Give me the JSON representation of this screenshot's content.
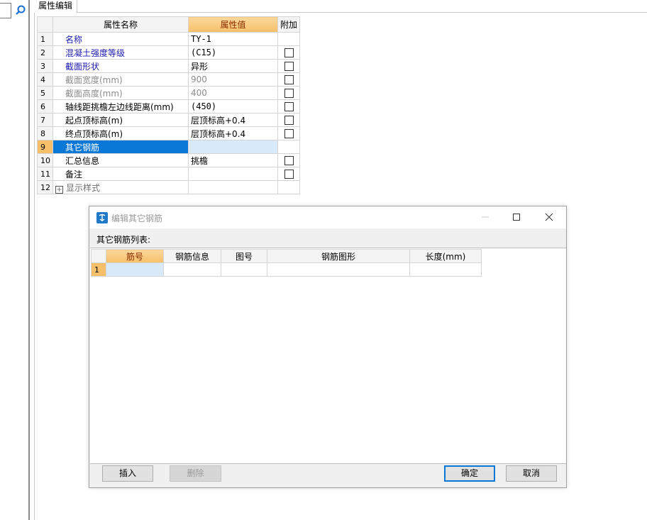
{
  "tab": {
    "label": "属性编辑"
  },
  "grid": {
    "headers": {
      "name": "属性名称",
      "value": "属性值",
      "extra": "附加"
    },
    "rows": [
      {
        "no": "1",
        "name": "名称",
        "value": "TY-1"
      },
      {
        "no": "2",
        "name": "混凝土强度等级",
        "value": "(C15)"
      },
      {
        "no": "3",
        "name": "截面形状",
        "value": "异形"
      },
      {
        "no": "4",
        "name": "截面宽度(mm)",
        "value": "900"
      },
      {
        "no": "5",
        "name": "截面高度(mm)",
        "value": "400"
      },
      {
        "no": "6",
        "name": "轴线距挑檐左边线距离(mm)",
        "value": "(450)"
      },
      {
        "no": "7",
        "name": "起点顶标高(m)",
        "value": "层顶标高+0.4"
      },
      {
        "no": "8",
        "name": "终点顶标高(m)",
        "value": "层顶标高+0.4"
      },
      {
        "no": "9",
        "name": "其它钢筋",
        "value": ""
      },
      {
        "no": "10",
        "name": "汇总信息",
        "value": "挑檐"
      },
      {
        "no": "11",
        "name": "备注",
        "value": ""
      },
      {
        "no": "12",
        "name": "显示样式",
        "value": ""
      }
    ]
  },
  "dialog": {
    "title": "编辑其它钢筋",
    "list_label": "其它钢筋列表:",
    "columns": [
      "筋号",
      "钢筋信息",
      "图号",
      "钢筋图形",
      "长度(mm)"
    ],
    "rows": [
      {
        "no": "1",
        "cells": [
          "",
          "",
          "",
          "",
          ""
        ]
      }
    ],
    "buttons": {
      "insert": "插入",
      "delete": "删除",
      "ok": "确定",
      "cancel": "取消"
    }
  }
}
